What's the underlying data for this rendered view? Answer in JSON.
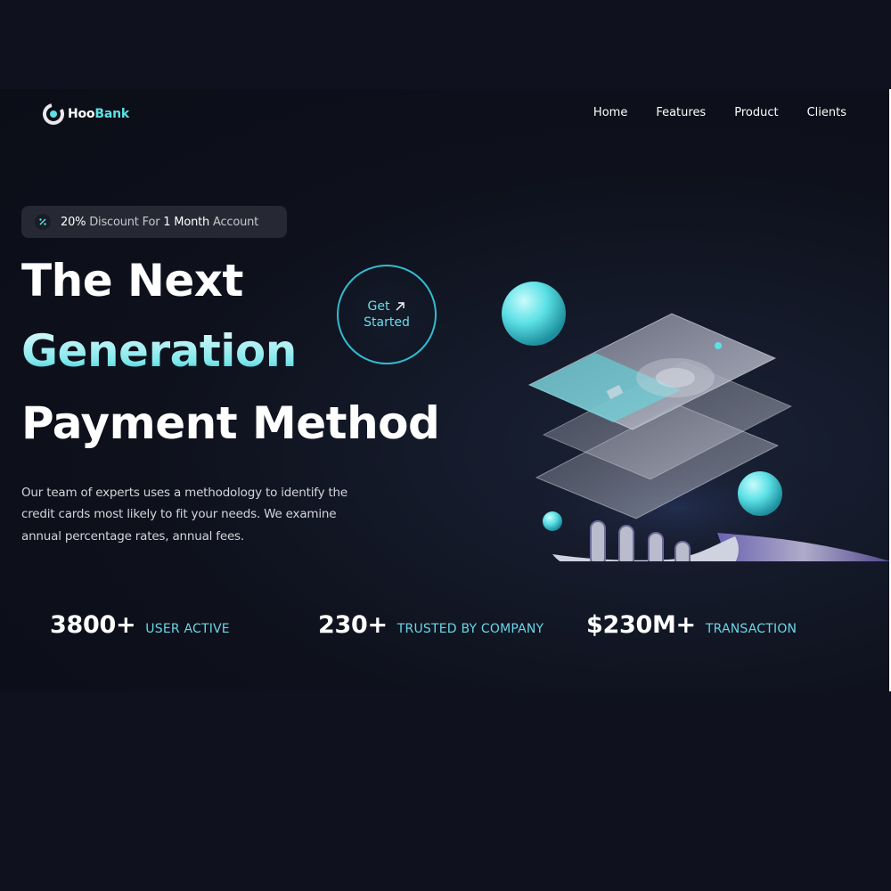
{
  "brand": {
    "name_part1": "Hoo",
    "name_part2": "Bank"
  },
  "nav": {
    "items": [
      "Home",
      "Features",
      "Product",
      "Clients"
    ]
  },
  "promo": {
    "percent": "20%",
    "text_mid": "Discount For",
    "months": "1 Month",
    "text_end": "Account"
  },
  "hero": {
    "line1": "The Next",
    "line2": "Generation",
    "line3": "Payment Method",
    "cta_line1": "Get",
    "cta_line2": "Started",
    "description": "Our team of experts uses a methodology to identify the credit cards most likely to fit your needs. We examine annual percentage rates, annual fees."
  },
  "stats": [
    {
      "value": "3800+",
      "label": "USER ACTIVE"
    },
    {
      "value": "230+",
      "label": "TRUSTED BY COMPANY"
    },
    {
      "value": "$230M+",
      "label": "TRANSACTION"
    }
  ],
  "colors": {
    "accent": "#5ce1e6",
    "accent_dark": "#33bbcf",
    "background": "#0f111e"
  }
}
